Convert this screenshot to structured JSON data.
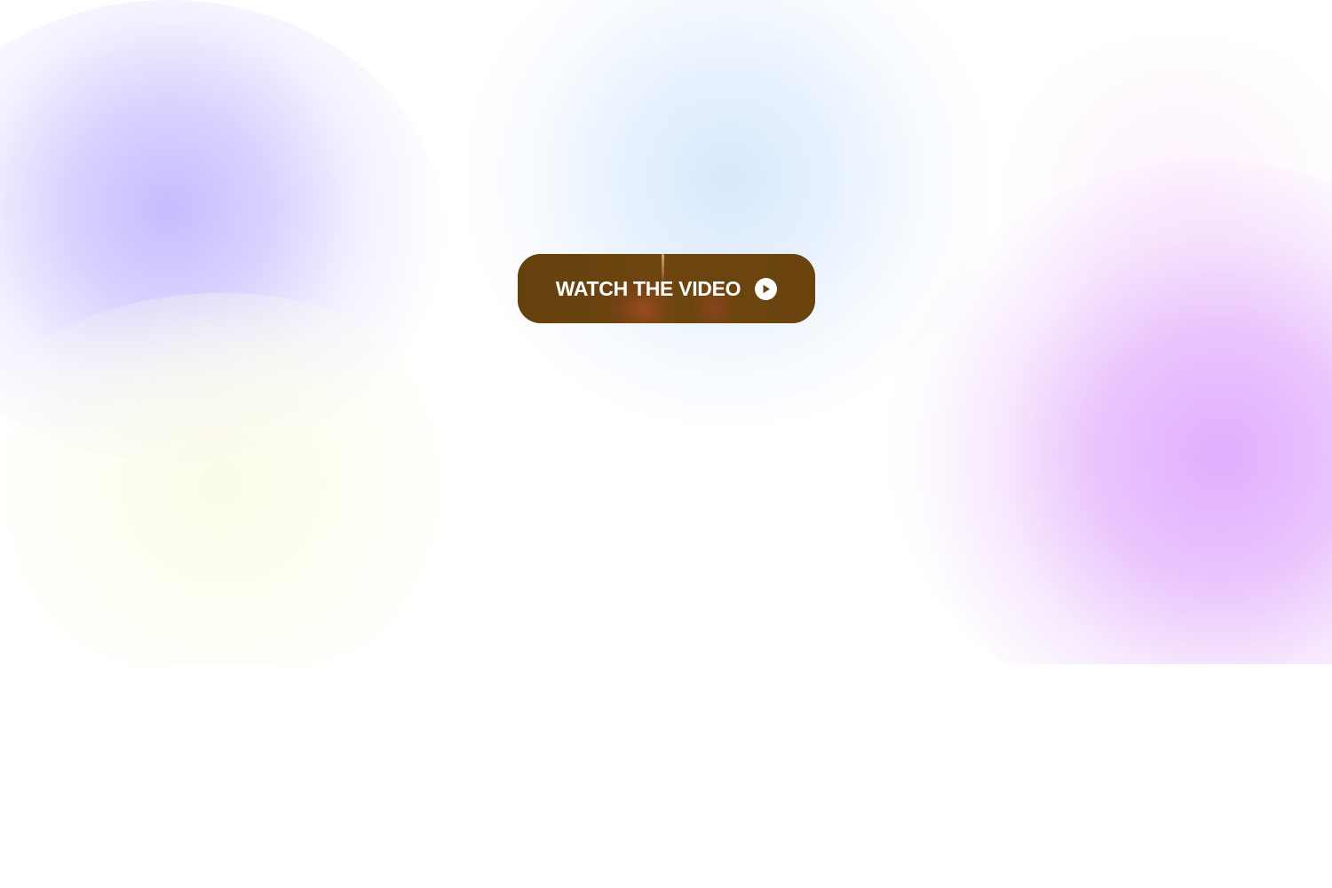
{
  "hero": {
    "cta": {
      "label": "WATCH THE VIDEO",
      "icon": "play-circle-icon",
      "background_color": "#6b440e",
      "text_color": "#ffffff"
    },
    "background_blobs": [
      {
        "name": "violet",
        "color": "#c4b8ff"
      },
      {
        "name": "yellow",
        "color": "#fcfce8"
      },
      {
        "name": "blue",
        "color": "#d6e8fc"
      },
      {
        "name": "magenta",
        "color": "#e0aaff"
      }
    ]
  }
}
